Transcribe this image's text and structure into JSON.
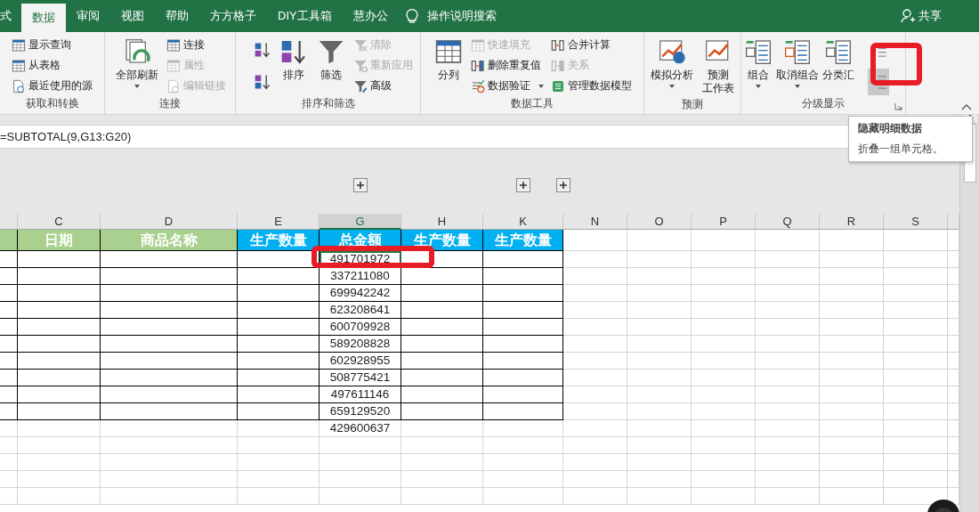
{
  "ribbon_tabs": [
    {
      "label": "式",
      "selected": false
    },
    {
      "label": "数据",
      "selected": true
    },
    {
      "label": "审阅",
      "selected": false
    },
    {
      "label": "视图",
      "selected": false
    },
    {
      "label": "帮助",
      "selected": false
    },
    {
      "label": "方方格子",
      "selected": false
    },
    {
      "label": "DIY工具箱",
      "selected": false
    },
    {
      "label": "慧办公",
      "selected": false
    }
  ],
  "tell_me": "操作说明搜索",
  "share": "共享",
  "ribbon_groups": [
    {
      "label": "获取和转换",
      "columns": [
        {
          "kind": "stack",
          "items": [
            {
              "label": "显示查询",
              "disabled": false
            },
            {
              "label": "从表格",
              "disabled": false
            },
            {
              "label": "最近使用的源",
              "disabled": false
            }
          ]
        }
      ]
    },
    {
      "label": "连接",
      "columns": [
        {
          "kind": "large",
          "items": [
            {
              "label": "全部刷新",
              "disabled": false,
              "dropdown": true
            }
          ]
        },
        {
          "kind": "stack",
          "items": [
            {
              "label": "连接",
              "disabled": false
            },
            {
              "label": "属性",
              "disabled": true
            },
            {
              "label": "编辑链接",
              "disabled": true
            }
          ]
        }
      ]
    },
    {
      "label": "排序和筛选",
      "columns": [
        {
          "kind": "icons",
          "items": [
            {
              "disabled": false
            },
            {
              "disabled": false
            }
          ]
        },
        {
          "kind": "large",
          "items": [
            {
              "label": "排序",
              "disabled": false
            }
          ]
        },
        {
          "kind": "large",
          "items": [
            {
              "label": "筛选",
              "disabled": false
            }
          ]
        },
        {
          "kind": "stack",
          "items": [
            {
              "label": "清除",
              "disabled": true
            },
            {
              "label": "重新应用",
              "disabled": true
            },
            {
              "label": "高级",
              "disabled": false
            }
          ]
        }
      ]
    },
    {
      "label": "数据工具",
      "columns": [
        {
          "kind": "large",
          "items": [
            {
              "label": "分列",
              "disabled": false
            }
          ]
        },
        {
          "kind": "stack",
          "items": [
            {
              "label": "快速填充",
              "disabled": true
            },
            {
              "label": "删除重复值",
              "disabled": false
            },
            {
              "label": "数据验证",
              "disabled": false,
              "dropdown": true
            }
          ]
        },
        {
          "kind": "stack",
          "items": [
            {
              "label": "合并计算",
              "disabled": false
            },
            {
              "label": "关系",
              "disabled": true
            },
            {
              "label": "管理数据模型",
              "disabled": false
            }
          ]
        }
      ]
    },
    {
      "label": "预测",
      "columns": [
        {
          "kind": "large",
          "items": [
            {
              "label": "模拟分析",
              "disabled": false,
              "dropdown": true
            }
          ]
        },
        {
          "kind": "large",
          "items": [
            {
              "lines": [
                "预测",
                "工作表"
              ],
              "disabled": false
            }
          ]
        }
      ]
    },
    {
      "label": "分级显示",
      "columns": [
        {
          "kind": "large",
          "items": [
            {
              "label": "组合",
              "disabled": false,
              "dropdown": true
            }
          ]
        },
        {
          "kind": "large",
          "items": [
            {
              "label": "取消组合",
              "disabled": false,
              "dropdown": true
            }
          ]
        },
        {
          "kind": "large",
          "items": [
            {
              "label": "分类汇",
              "disabled": false
            }
          ]
        },
        {
          "kind": "icons",
          "items": [
            {
              "hovered": false
            },
            {
              "hovered": true
            }
          ]
        }
      ]
    }
  ],
  "formula": "=SUBTOTAL(9,G13:G20)",
  "tooltip": {
    "title": "隐藏明细数据",
    "text": "折叠一组单元格。"
  },
  "column_headers": [
    {
      "label": "C",
      "selected": false
    },
    {
      "label": "D",
      "selected": false
    },
    {
      "label": "E",
      "selected": false
    },
    {
      "label": "G",
      "selected": true
    },
    {
      "label": "H",
      "selected": false
    },
    {
      "label": "K",
      "selected": false
    },
    {
      "label": "N",
      "selected": false
    },
    {
      "label": "O",
      "selected": false
    },
    {
      "label": "P",
      "selected": false
    },
    {
      "label": "Q",
      "selected": false
    },
    {
      "label": "R",
      "selected": false
    },
    {
      "label": "S",
      "selected": false
    }
  ],
  "table": {
    "header": [
      {
        "color": "#a9d08e"
      },
      {
        "text": "日期",
        "color": "#a9d08e"
      },
      {
        "text": "商品名称",
        "color": "#a9d08e"
      },
      {
        "text": "生产数量",
        "color": "#00b0f0"
      },
      {
        "text": "总金额",
        "color": "#00b0f0"
      },
      {
        "text": "生产数量",
        "color": "#00b0f0"
      },
      {
        "text": "生产数量",
        "color": "#00b0f0"
      }
    ],
    "rows": [
      {
        "amount": "491701972",
        "bordered": true,
        "active": true
      },
      {
        "amount": "337211080",
        "bordered": true,
        "active": false
      },
      {
        "amount": "699942242",
        "bordered": true,
        "active": false
      },
      {
        "amount": "623208641",
        "bordered": true,
        "active": false
      },
      {
        "amount": "600709928",
        "bordered": true,
        "active": false
      },
      {
        "amount": "589208828",
        "bordered": true,
        "active": false
      },
      {
        "amount": "602928955",
        "bordered": true,
        "active": false
      },
      {
        "amount": "508775421",
        "bordered": true,
        "active": false
      },
      {
        "amount": "497611146",
        "bordered": true,
        "active": false
      },
      {
        "amount": "659129520",
        "bordered": true,
        "active": false
      },
      {
        "amount": "429600637",
        "bordered": false,
        "active": false
      }
    ]
  }
}
